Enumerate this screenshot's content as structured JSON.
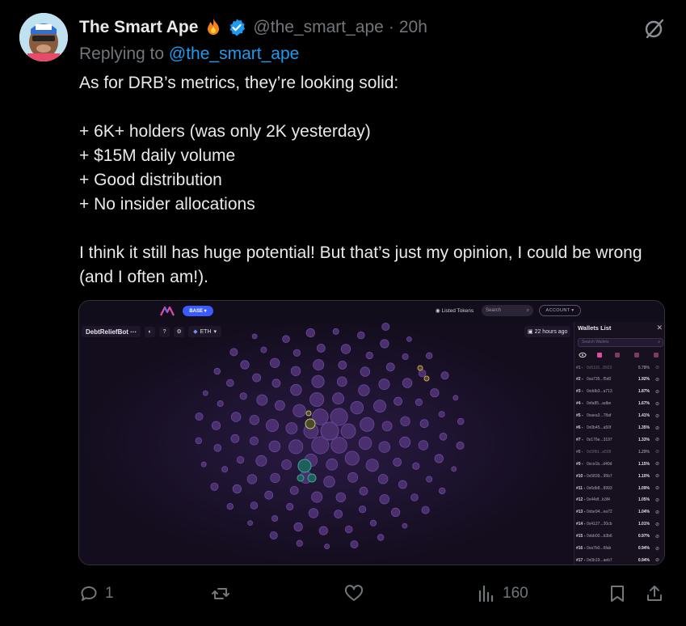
{
  "tweet": {
    "display_name": "The Smart Ape",
    "handle": "@the_smart_ape",
    "separator": "·",
    "time": "20h",
    "replying_prefix": "Replying to",
    "replying_handle": "@the_smart_ape",
    "body": {
      "line1": "As for DRB’s metrics, they’re looking solid:",
      "bullets": [
        "+ 6K+ holders (was only 2K yesterday)",
        "+ $15M daily volume",
        "+ Good distribution",
        "+ No insider allocations"
      ],
      "closing": "I think it still has huge potential! But that’s just my opinion, I could be wrong (and I often am!)."
    },
    "colors": {
      "link": "#1d9bf0",
      "muted": "#71767b",
      "text": "#e7e9ea",
      "verified": "#1d9bf0"
    }
  },
  "media": {
    "network_pill": "BASE",
    "listed_tokens": "Listed Tokens",
    "search_placeholder": "Search",
    "account_button": "ACCOUNT",
    "token_name": "DebtReliefBot",
    "token_more": "···",
    "chain": "ETH",
    "time_ago": "22 hours ago",
    "wallets_title": "Wallets List",
    "wallets_search_placeholder": "Search Wallets",
    "wallets": [
      {
        "rank": "#1 -",
        "addr": "0x5116...8923",
        "pct": "5.78%",
        "dim": true
      },
      {
        "rank": "#2 -",
        "addr": "0xa735...f5d0",
        "pct": "1.92%",
        "dim": false
      },
      {
        "rank": "#3 -",
        "addr": "0xddb3...a713",
        "pct": "1.87%",
        "dim": false
      },
      {
        "rank": "#4 -",
        "addr": "0xfa85...adbe",
        "pct": "1.67%",
        "dim": false
      },
      {
        "rank": "#5 -",
        "addr": "0xaea3...78af",
        "pct": "1.41%",
        "dim": false
      },
      {
        "rank": "#6 -",
        "addr": "0x0b45...a50f",
        "pct": "1.35%",
        "dim": false
      },
      {
        "rank": "#7 -",
        "addr": "0x176e...3197",
        "pct": "1.33%",
        "dim": false
      },
      {
        "rank": "#8 -",
        "addr": "0x5f8d...a508",
        "pct": "1.29%",
        "dim": true
      },
      {
        "rank": "#9 -",
        "addr": "0xce1b...d40d",
        "pct": "1.15%",
        "dim": false
      },
      {
        "rank": "#10 -",
        "addr": "0x5839...95b7",
        "pct": "1.10%",
        "dim": false
      },
      {
        "rank": "#11 -",
        "addr": "0x6db8...8993",
        "pct": "1.09%",
        "dim": false
      },
      {
        "rank": "#12 -",
        "addr": "0x44df...b3f4",
        "pct": "1.05%",
        "dim": false
      },
      {
        "rank": "#13 -",
        "addr": "0xbe94...ea72",
        "pct": "1.04%",
        "dim": false
      },
      {
        "rank": "#14 -",
        "addr": "0x4127...20cb",
        "pct": "1.01%",
        "dim": false
      },
      {
        "rank": "#15 -",
        "addr": "0xbb00...b3b6",
        "pct": "0.97%",
        "dim": false
      },
      {
        "rank": "#16 -",
        "addr": "0xa7b0...6fab",
        "pct": "0.94%",
        "dim": false
      },
      {
        "rank": "#17 -",
        "addr": "0x0b19...aeb7",
        "pct": "0.94%",
        "dim": false
      }
    ],
    "bubble_color": "#4a2f6e",
    "bubble_stroke": "#6b4a99"
  },
  "actions": {
    "replies": "1",
    "reposts": "",
    "likes": "",
    "views": "160"
  }
}
